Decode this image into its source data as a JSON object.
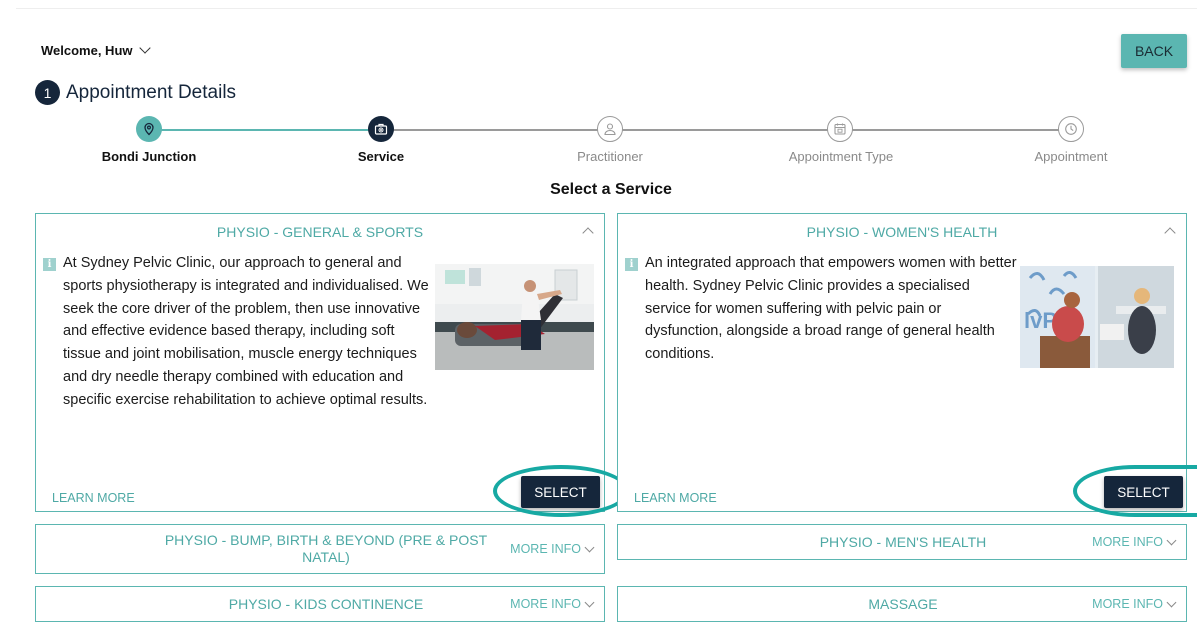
{
  "header": {
    "welcome_label": "Welcome, Huw",
    "back_label": "BACK"
  },
  "section": {
    "step_number": "1",
    "title": "Appointment Details"
  },
  "stepper": {
    "steps": [
      {
        "label": "Bondi Junction",
        "icon": "location-pin-icon",
        "state": "done"
      },
      {
        "label": "Service",
        "icon": "medical-bag-icon",
        "state": "current"
      },
      {
        "label": "Practitioner",
        "icon": "person-icon",
        "state": "pending"
      },
      {
        "label": "Appointment Type",
        "icon": "calendar-icon",
        "state": "pending"
      },
      {
        "label": "Appointment",
        "icon": "clock-icon",
        "state": "pending"
      }
    ]
  },
  "heading": "Select a Service",
  "services_expanded": [
    {
      "title": "PHYSIO - GENERAL & SPORTS",
      "info_icon": "i",
      "description": "At Sydney Pelvic Clinic, our approach to general and sports physiotherapy is integrated and individualised. We seek the core driver of the problem, then use innovative and effective evidence based therapy, including soft tissue and joint mobilisation, muscle energy techniques and dry needle therapy combined with education and specific exercise rehabilitation to achieve optimal results.",
      "learn_more": "LEARN MORE",
      "select_label": "SELECT"
    },
    {
      "title": "PHYSIO - WOMEN'S HEALTH",
      "info_icon": "i",
      "description": "An integrated approach that empowers women with better health. Sydney Pelvic Clinic provides a specialised service for women suffering with pelvic pain or dysfunction, alongside a broad range of general health conditions.",
      "learn_more": "LEARN MORE",
      "select_label": "SELECT"
    }
  ],
  "services_collapsed": [
    {
      "title": "PHYSIO - BUMP, BIRTH & BEYOND (PRE & POST NATAL)",
      "more_label": "MORE INFO"
    },
    {
      "title": "PHYSIO - MEN'S HEALTH",
      "more_label": "MORE INFO"
    },
    {
      "title": "PHYSIO - KIDS CONTINENCE",
      "more_label": "MORE INFO"
    },
    {
      "title": "MASSAGE",
      "more_label": "MORE INFO"
    }
  ],
  "colors": {
    "accent": "#5bb6b1",
    "navy": "#15263b",
    "highlight_ring": "#17a9a3"
  }
}
